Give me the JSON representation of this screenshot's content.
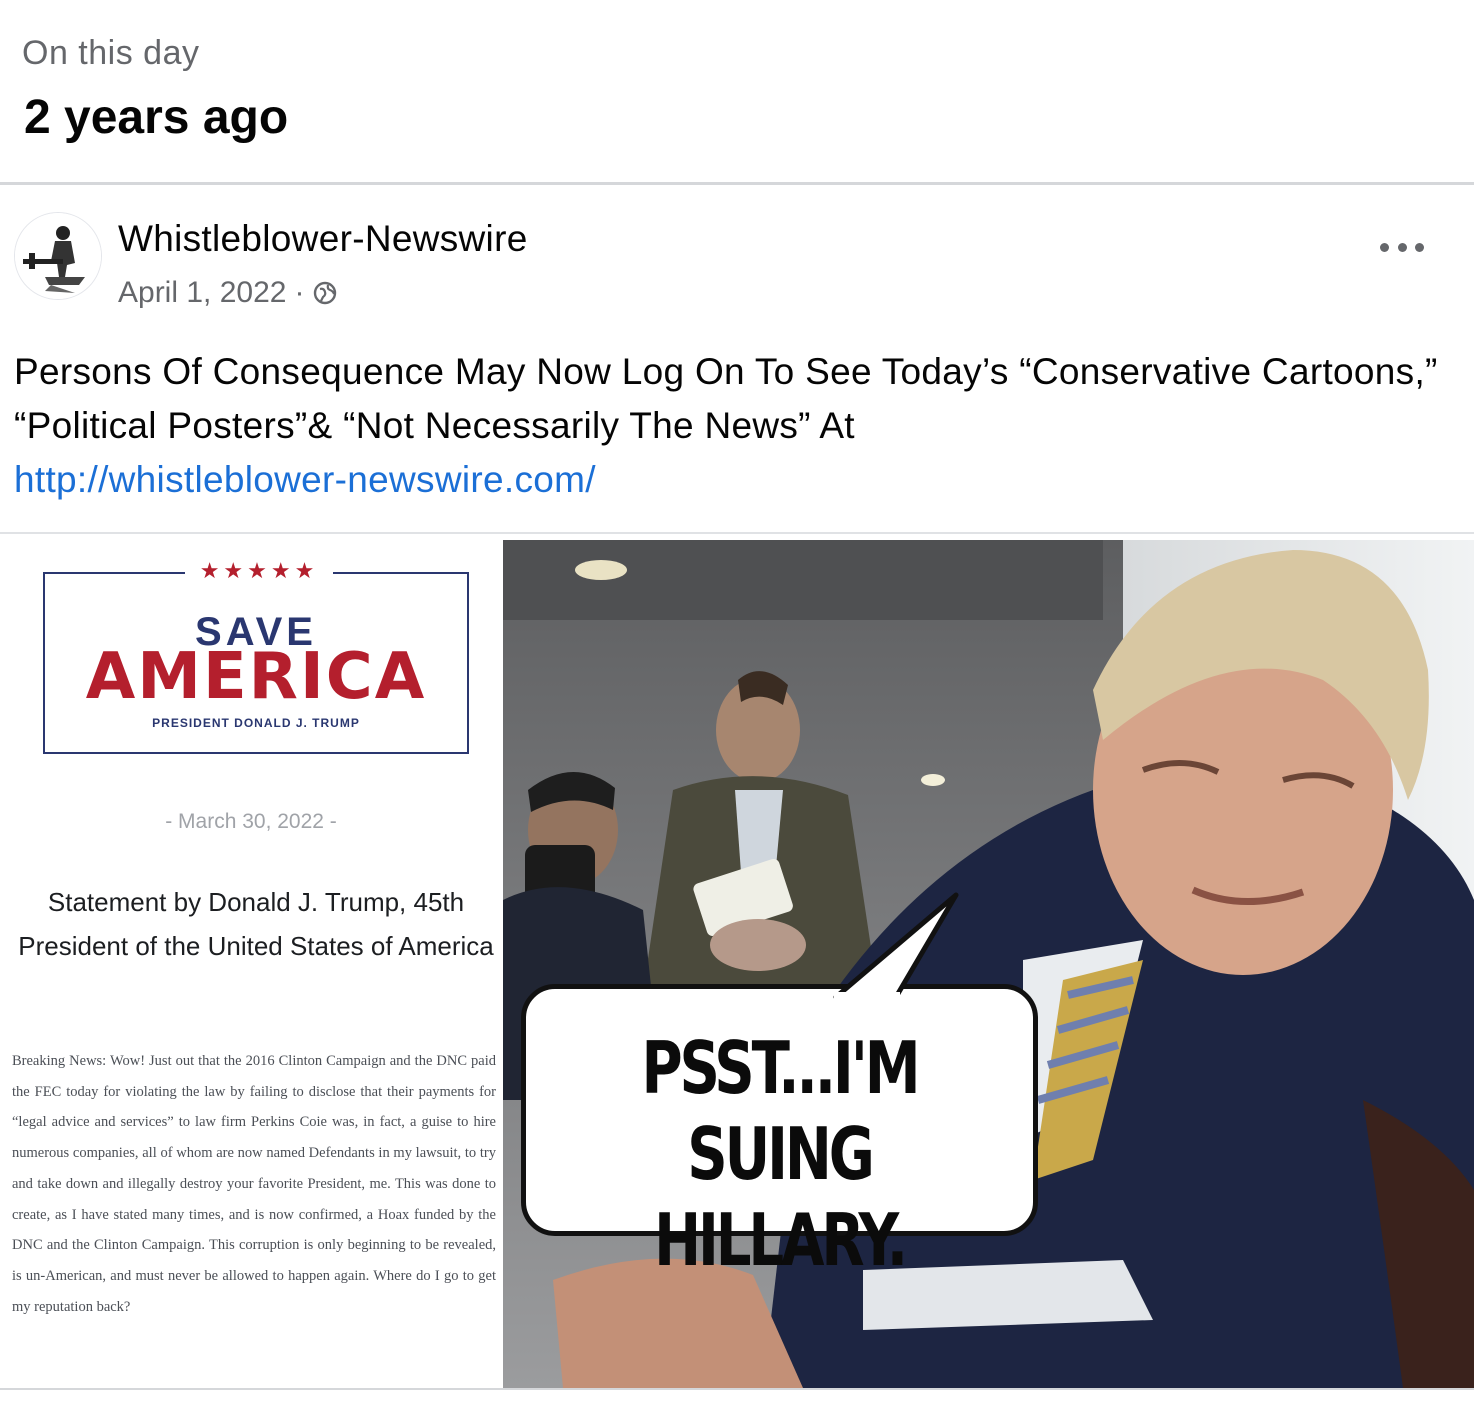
{
  "memory": {
    "label": "On this day",
    "when": "2 years ago"
  },
  "post": {
    "page_name": "Whistleblower-Newswire",
    "date": "April 1, 2022",
    "separator": "·",
    "privacy_icon": "globe-icon",
    "more_icon": "more-options-icon",
    "text": "Persons Of Consequence May Now Log On To See Today’s “Conservative Cartoons,” “Political Posters”& “Not Necessarily The News” At",
    "link": "http://whistleblower-newswire.com/"
  },
  "statement": {
    "stars": "★★★★★",
    "save": "SAVE",
    "america": "AMERICA",
    "president": "PRESIDENT DONALD J. TRUMP",
    "date": "- March 30, 2022 -",
    "title": "Statement by Donald J. Trump, 45th President of the United States of America",
    "body": "Breaking News: Wow! Just out that the 2016 Clinton Campaign and the DNC paid the FEC today for violating the law by failing to disclose that their payments for “legal advice and services” to law firm Perkins Coie was, in fact, a guise to hire numerous companies, all of whom are now named Defendants in my lawsuit, to try and take down and illegally destroy your favorite President, me. This was done to create, as I have stated many times, and is now confirmed, a Hoax funded by the DNC and the Clinton Campaign. This corruption is only beginning to be revealed, is un-American, and must never be allowed to happen again. Where do I go to get my reputation back?"
  },
  "cartoon": {
    "bubble_line1": "PSST...I'M",
    "bubble_line2": "SUING HILLARY."
  },
  "colors": {
    "link": "#1b6fd6",
    "secondary_text": "#65676b",
    "save_america_red": "#b41f2d",
    "save_america_blue": "#2a3770"
  }
}
